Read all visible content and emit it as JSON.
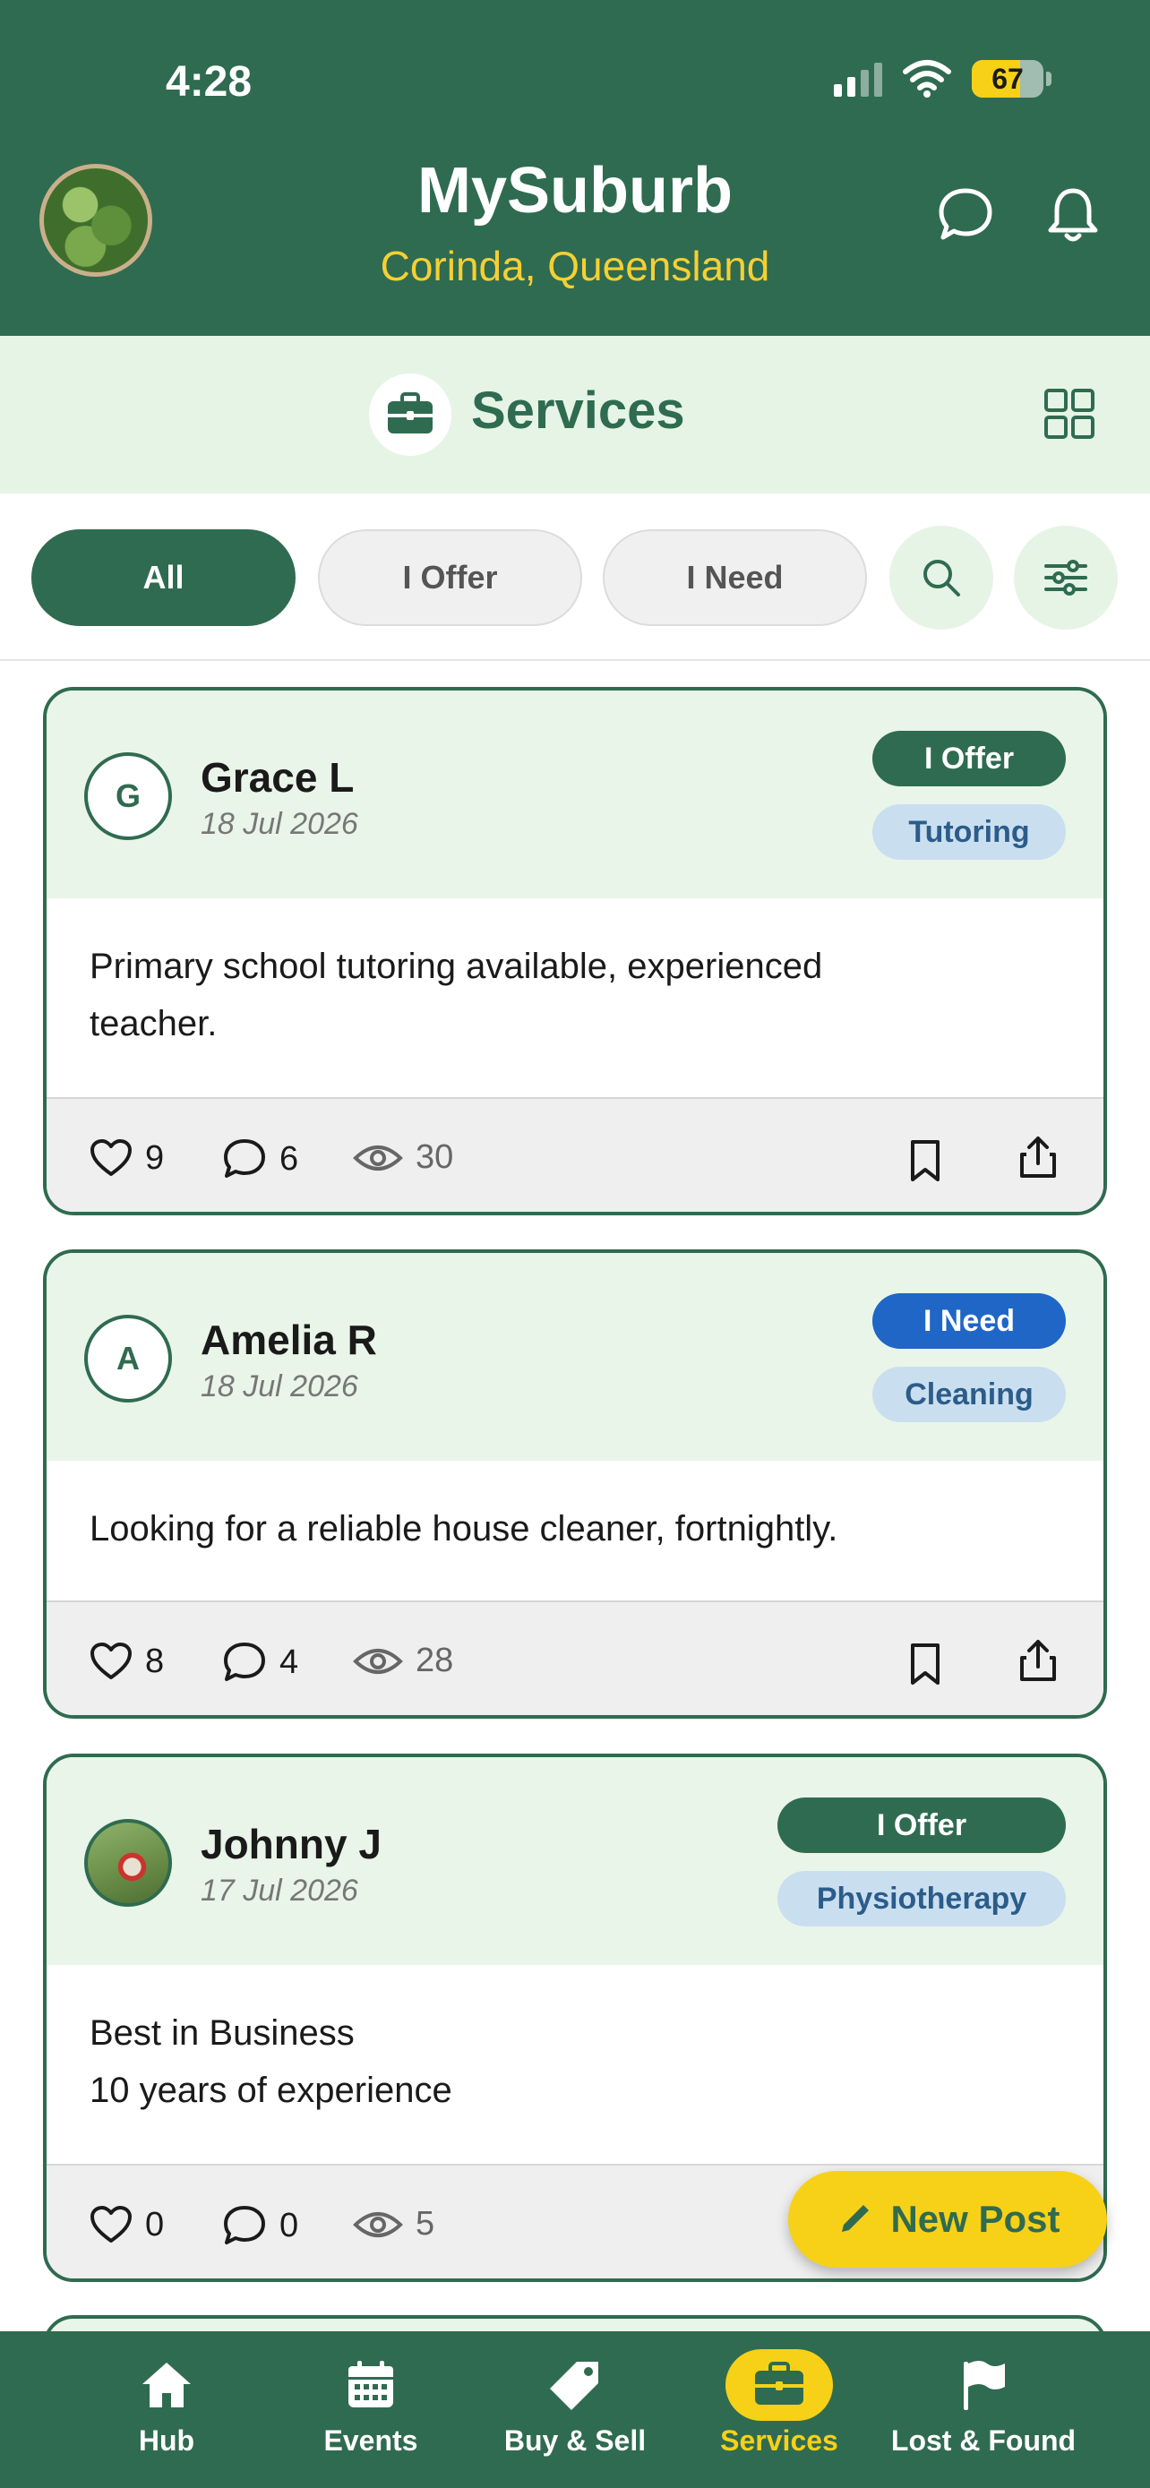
{
  "status_bar": {
    "time": "4:28",
    "battery": "67",
    "battery_level": 0.67
  },
  "header": {
    "title": "MySuburb",
    "subtitle": "Corinda, Queensland"
  },
  "section": {
    "title": "Services"
  },
  "filters": {
    "all": "All",
    "offer": "I Offer",
    "need": "I Need"
  },
  "posts": [
    {
      "avatar_letter": "G",
      "name": "Grace L",
      "date": "18 Jul 2026",
      "type": "I Offer",
      "category": "Tutoring",
      "text": "Primary school tutoring available, experienced\nteacher.",
      "likes": "9",
      "comments": "6",
      "views": "30"
    },
    {
      "avatar_letter": "A",
      "name": "Amelia R",
      "date": "18 Jul 2026",
      "type": "I Need",
      "category": "Cleaning",
      "text": "Looking for a reliable house cleaner, fortnightly.",
      "likes": "8",
      "comments": "4",
      "views": "28"
    },
    {
      "name": "Johnny J",
      "date": "17 Jul 2026",
      "type": "I Offer",
      "category": "Physiotherapy",
      "text": "Best in Business\n10 years of experience",
      "likes": "0",
      "comments": "0",
      "views": "5"
    }
  ],
  "fab": {
    "label": "New Post"
  },
  "nav": {
    "hub": "Hub",
    "events": "Events",
    "buy_sell": "Buy & Sell",
    "services": "Services",
    "lost_found": "Lost & Found"
  },
  "colors": {
    "primary": "#2f6b50",
    "accent": "#f7d117",
    "need_badge": "#1f66c6",
    "category_badge": "#c9dff0",
    "light_green": "#e6f4e5"
  },
  "icons": [
    "chat-icon",
    "bell-icon",
    "briefcase-icon",
    "grid-icon",
    "search-icon",
    "filter-sliders-icon",
    "heart-icon",
    "comment-icon",
    "eye-icon",
    "bookmark-icon",
    "share-icon",
    "pencil-icon",
    "home-icon",
    "calendar-icon",
    "tag-icon",
    "flag-icon"
  ]
}
